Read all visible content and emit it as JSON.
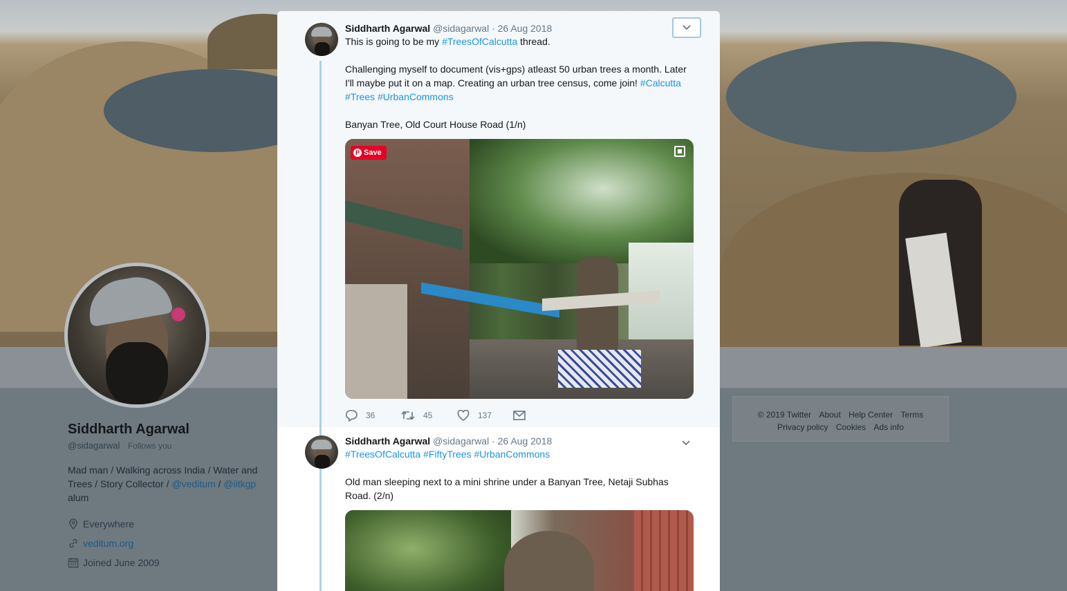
{
  "profile": {
    "name": "Siddharth Agarwal",
    "handle": "@sidagarwal",
    "follows_you": "Follows you",
    "bio_part1": "Mad man / Walking across India / Water and Trees / Story Collector / ",
    "bio_link1": "@veditum",
    "bio_sep": " / ",
    "bio_link2": "@iitkgp",
    "bio_part2": " alum",
    "location": "Everywhere",
    "website": "veditum.org",
    "joined": "Joined June 2009"
  },
  "footer": {
    "copyright": "© 2019 Twitter",
    "links_row1": [
      "About",
      "Help Center",
      "Terms"
    ],
    "links_row2": [
      "Privacy policy",
      "Cookies",
      "Ads info"
    ]
  },
  "tweets": [
    {
      "name": "Siddharth Agarwal",
      "handle": "@sidagarwal",
      "date": "· 26 Aug 2018",
      "line1_pre": "This is going to be my ",
      "line1_tag": "#TreesOfCalcutta",
      "line1_post": " thread.",
      "para2_pre": "Challenging myself to document (vis+gps) atleast 50 urban trees a month. Later I'll maybe put it on a map. Creating an urban tree census, come join! ",
      "tag_calcutta": "#Calcutta",
      "tag_trees": "#Trees",
      "tag_commons": "#UrbanCommons",
      "para3": "Banyan Tree, Old Court House Road (1/n)",
      "pin_label": "Save",
      "replies": "36",
      "retweets": "45",
      "likes": "137"
    },
    {
      "name": "Siddharth Agarwal",
      "handle": "@sidagarwal",
      "date": "· 26 Aug 2018",
      "tag1": "#TreesOfCalcutta",
      "tag2": "#FiftyTrees",
      "tag3": "#UrbanCommons",
      "para2": "Old man sleeping next to a mini shrine under a Banyan Tree, Netaji Subhas Road. (2/n)"
    }
  ],
  "icons": {
    "caret": "chevron-down-icon",
    "reply": "reply-icon",
    "retweet": "retweet-icon",
    "like": "heart-icon",
    "dm": "envelope-icon",
    "location": "location-pin-icon",
    "link": "link-icon",
    "calendar": "calendar-icon"
  },
  "colors": {
    "link": "#1b95e0",
    "thread_line": "#a8d3ec",
    "pinterest": "#e60023"
  }
}
